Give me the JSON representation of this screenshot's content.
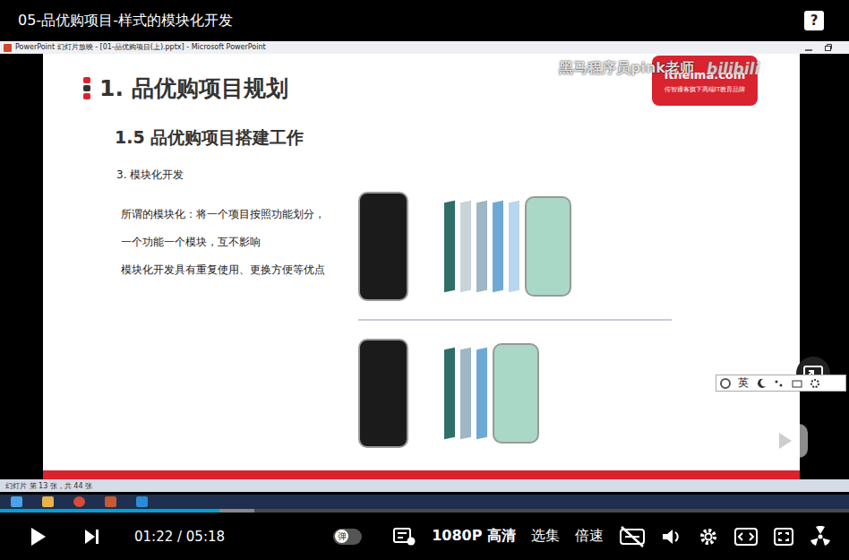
{
  "video": {
    "title": "05-品优购项目-样式的模块化开发",
    "help_button": "?"
  },
  "powerpoint": {
    "title": "PowerPoint 幻灯片放映 - [01-品优购项目(上).pptx] - Microsoft PowerPoint",
    "status": "幻灯片 第 13 张，共 44 张"
  },
  "slide": {
    "heading": "1. 品优购项目规划",
    "subheading": "1.5 品优购项目搭建工作",
    "item": "3. 模块化开发",
    "paragraphs": [
      "所谓的模块化：将一个项目按照功能划分，",
      "一个功能一个模块，互不影响",
      "模块化开发具有重复使用、更换方便等优点"
    ]
  },
  "logo": {
    "brand": "itheima.com",
    "slogan": "传智播客旗下高端IT教育品牌"
  },
  "watermark": {
    "text": "黑马程序员pink老师",
    "site": "bilibili"
  },
  "ime": {
    "language": "英"
  },
  "player": {
    "current_time": "01:22",
    "separator": "/",
    "total_time": "05:18",
    "progress": 0.258,
    "buffered": 0.3,
    "danmaku": {
      "label": "弹",
      "on": false
    },
    "quality": "1080P 高清",
    "buttons": [
      "选集",
      "倍速"
    ]
  }
}
